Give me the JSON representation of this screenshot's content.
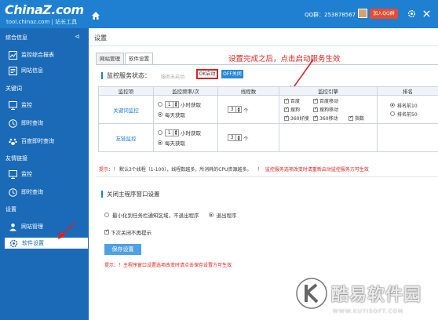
{
  "header": {
    "logo": "ChinaZ.com",
    "logo_sub": "tool.chinaz.com | 站长工具",
    "qq_group": "QQ群：253878567",
    "join_qq": "加入QQ群"
  },
  "sidebar": {
    "sections": [
      "综合信息",
      "关键词",
      "友情链接",
      "设置"
    ],
    "items": [
      {
        "label": "监控综合报表",
        "icon": "chart-icon"
      },
      {
        "label": "网站信息",
        "icon": "document-icon"
      },
      {
        "label": "监控",
        "icon": "monitor-icon"
      },
      {
        "label": "即时查询",
        "icon": "clock-icon"
      },
      {
        "label": "百度即时查询",
        "icon": "paw-icon"
      },
      {
        "label": "监控",
        "icon": "monitor-icon"
      },
      {
        "label": "即时查询",
        "icon": "clock-icon"
      },
      {
        "label": "网站管理",
        "icon": "user-icon"
      },
      {
        "label": "软件设置",
        "icon": "gear-icon"
      }
    ]
  },
  "main": {
    "breadcrumb": "设置",
    "tabs": [
      "网站管理",
      "软件设置"
    ],
    "hint": "设置完成之后，点击启动服务生效",
    "service_label": "监控服务状态：",
    "service_status": "服务未启动",
    "ok_button": "OK启动",
    "off_button": "OFF关闭",
    "table": {
      "headers": [
        "监控项",
        "监控频率/次",
        "线程数",
        "监控引擎",
        "排名"
      ],
      "rows": [
        {
          "name": "关键词监控",
          "freq_value": "1",
          "freq_unit": "小时获取",
          "daily": "每天获取",
          "threads": "3",
          "thread_unit": "个",
          "engines": [
            "百度",
            "百度移动",
            "搜狗",
            "搜狗移动",
            "360好搜",
            "360移动",
            "指数"
          ],
          "ranks": [
            "排名前10",
            "排名前50"
          ]
        },
        {
          "name": "友链监控",
          "freq_value": "1",
          "freq_unit": "小时获取",
          "daily": "每天获取",
          "threads": "3",
          "thread_unit": "个"
        }
      ]
    },
    "tip_prefix": "提示：！",
    "tip_text": "默认3个线程（1-100），线程数越多，所消耗的CPU资源越多。",
    "tip_bang": "！",
    "tip_red": "监控服务选项改变时请重新启动监控服务方可生效",
    "close_label": "关闭主程序窗口设置",
    "minimize_option": "最小化到任务栏通知区域，不退出程序",
    "exit_option": "退出程序",
    "no_more": "下次关闭不再提示",
    "save_button": "保存设置",
    "tip2": "提示：！主程序窗口设置选项改变时请点击保存设置方可生效"
  },
  "watermark": {
    "text": "酷易软件园",
    "url": "WWW.KUYISOFT.COM"
  },
  "colors": {
    "topbar": "#1f7fd0",
    "sidebar": "#1a6ab8",
    "accent_red": "#e02020"
  }
}
